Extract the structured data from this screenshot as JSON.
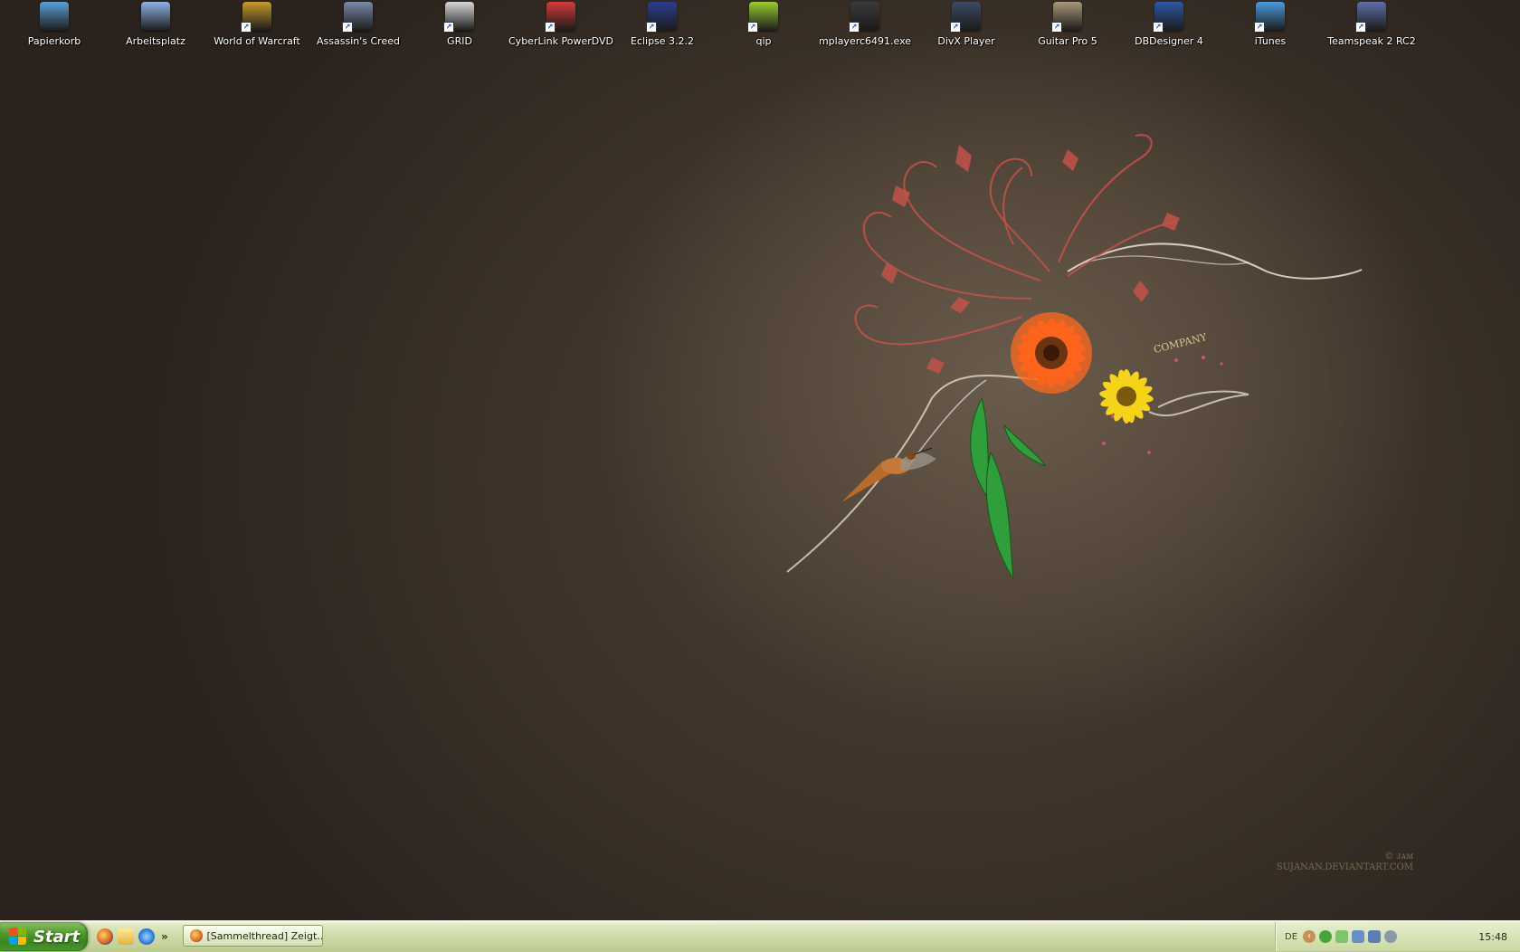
{
  "desktop": {
    "icons": [
      {
        "label": "Papierkorb",
        "icon": "recycle-bin-icon",
        "color": "#5aa0d8"
      },
      {
        "label": "Arbeitsplatz",
        "icon": "my-computer-icon",
        "color": "#8fb3e6"
      },
      {
        "label": "World of Warcraft",
        "icon": "world-of-warcraft-icon",
        "color": "#c79a2a"
      },
      {
        "label": "Assassin's Creed",
        "icon": "assassins-creed-icon",
        "color": "#7a8aa8"
      },
      {
        "label": "GRID",
        "icon": "grid-icon",
        "color": "#d7d7d7"
      },
      {
        "label": "CyberLink PowerDVD",
        "icon": "powerdvd-icon",
        "color": "#d63a3a"
      },
      {
        "label": "Eclipse 3.2.2",
        "icon": "eclipse-icon",
        "color": "#2c3d8f"
      },
      {
        "label": "qip",
        "icon": "qip-icon",
        "color": "#9acd32"
      },
      {
        "label": "mplayerc6491.exe",
        "icon": "media-player-classic-icon",
        "color": "#3a3a3a"
      },
      {
        "label": "DivX Player",
        "icon": "divx-player-icon",
        "color": "#3c4a63"
      },
      {
        "label": "Guitar Pro 5",
        "icon": "guitar-pro-icon",
        "color": "#a89878"
      },
      {
        "label": "DBDesigner 4",
        "icon": "dbdesigner-icon",
        "color": "#2e58a6"
      },
      {
        "label": "iTunes",
        "icon": "itunes-icon",
        "color": "#4c9be0"
      },
      {
        "label": "Teamspeak 2 RC2",
        "icon": "teamspeak-icon",
        "color": "#5f6fa8"
      }
    ],
    "wallpaper": {
      "text": "COMPANY",
      "signature_line1": "© ᴊᴀᴍ",
      "signature_line2": "SUJANAN.DEVIANTART.COM"
    }
  },
  "taskbar": {
    "start_label": "Start",
    "quick_launch": [
      "firefox-icon",
      "explorer-folder-icon",
      "internet-explorer-icon"
    ],
    "more_label": "»",
    "task": {
      "label": "[Sammelthread] Zeigt...",
      "icon": "firefox-icon"
    },
    "tray": {
      "language": "DE",
      "collapse_label": "‹",
      "icons": [
        "network-icon",
        "messenger-icon",
        "volume-icon",
        "display-icon",
        "security-icon"
      ],
      "clock": "15:48"
    }
  }
}
